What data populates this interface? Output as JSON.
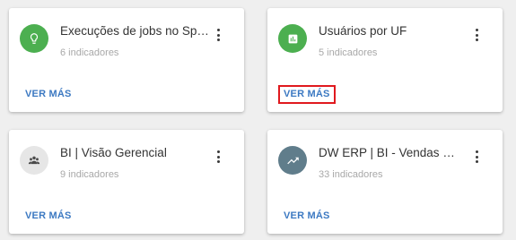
{
  "colors": {
    "green_avatar": "#4caf50",
    "grey_avatar": "#e6e6e6",
    "slate_avatar": "#607d8b",
    "link": "#3c79c2",
    "highlight": "#e0191e"
  },
  "cards": [
    {
      "title": "Execuções de jobs no Spark",
      "subtitle": "6 indicadores",
      "more_label": "VER MÁS",
      "icon": "lightbulb-icon"
    },
    {
      "title": "Usuários por UF",
      "subtitle": "5 indicadores",
      "more_label": "VER MÁS",
      "icon": "bar-chart-icon"
    },
    {
      "title": "BI | Visão Gerencial",
      "subtitle": "9 indicadores",
      "more_label": "VER MÁS",
      "icon": "people-icon"
    },
    {
      "title": "DW ERP | BI - Vendas Gerenciais",
      "subtitle": "33 indicadores",
      "more_label": "VER MÁS",
      "icon": "trending-up-icon"
    }
  ]
}
